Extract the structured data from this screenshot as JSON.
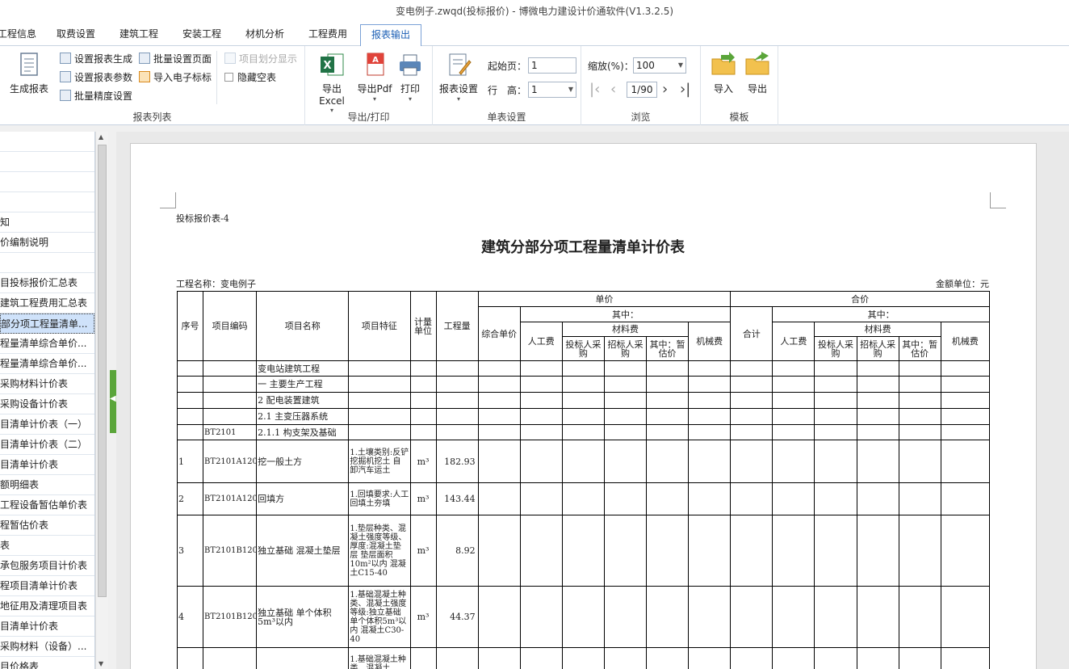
{
  "window": {
    "title": "变电例子.zwqd(投标报价) - 博微电力建设计价通软件(V1.3.2.5)"
  },
  "tabs": [
    "工程信息",
    "取费设置",
    "建筑工程",
    "安装工程",
    "材机分析",
    "工程费用",
    "报表输出"
  ],
  "ribbon": {
    "report_list": {
      "label": "报表列表",
      "generate": "生成报表",
      "set_generate": "设置报表生成",
      "batch_page": "批量设置页面",
      "set_params": "设置报表参数",
      "import_bid": "导入电子标标",
      "batch_precision": "批量精度设置",
      "item_display": "项目划分显示",
      "hide_empty": "隐藏空表"
    },
    "export": {
      "label": "导出/打印",
      "excel": "导出Excel",
      "pdf": "导出Pdf",
      "print": "打印"
    },
    "single": {
      "label": "单表设置",
      "button": "报表设置",
      "start_page_label": "起始页：",
      "start_page": "1",
      "row_height_label": "行　高：",
      "row_height": "1"
    },
    "browse": {
      "label": "浏览",
      "zoom_label": "缩放(%)：",
      "zoom": "100",
      "page": "1/90"
    },
    "template": {
      "label": "模板",
      "import": "导入",
      "export": "导出"
    }
  },
  "left_list": [
    "",
    "",
    "",
    "",
    "知",
    "价编制说明",
    "",
    "目投标报价汇总表",
    "建筑工程费用汇总表",
    "部分项工程量清单...",
    "程量清单综合单价...",
    "程量清单综合单价...",
    "采购材料计价表",
    "采购设备计价表",
    "目清单计价表（一）",
    "目清单计价表（二）",
    "目清单计价表",
    "额明细表",
    "工程设备暂估单价表",
    "程暂估价表",
    "表",
    "承包服务项目计价表",
    "程项目清单计价表",
    "地征用及清理项目表",
    "目清单计价表",
    "采购材料（设备）...",
    "目价格表"
  ],
  "report": {
    "sub": "投标报价表-4",
    "title": "建筑分部分项工程量清单计价表",
    "project": "工程名称：变电例子",
    "unit": "金额单位：元",
    "headers": {
      "seq": "序号",
      "code": "项目编码",
      "name": "项目名称",
      "feature": "项目特征",
      "unit": "计量单位",
      "qty": "工程量",
      "unit_price": "单价",
      "total_price": "合价",
      "combined": "综合单价",
      "total": "合计",
      "among": "其中：",
      "labor": "人工费",
      "material": "材料费",
      "bidder_buy": "投标人采购",
      "tenderer_buy": "招标人采购",
      "provisional": "其中：暂估价",
      "machine": "机械费"
    },
    "rows": [
      {
        "seq": "",
        "code": "",
        "name": "变电站建筑工程",
        "feature": "",
        "unit": "",
        "qty": ""
      },
      {
        "seq": "",
        "code": "",
        "name": "一 主要生产工程",
        "feature": "",
        "unit": "",
        "qty": ""
      },
      {
        "seq": "",
        "code": "",
        "name": "2 配电装置建筑",
        "feature": "",
        "unit": "",
        "qty": ""
      },
      {
        "seq": "",
        "code": "",
        "name": "2.1 主变压器系统",
        "feature": "",
        "unit": "",
        "qty": ""
      },
      {
        "seq": "",
        "code": "BT2101",
        "name": "2.1.1 构支架及基础",
        "feature": "",
        "unit": "",
        "qty": ""
      },
      {
        "seq": "1",
        "code": "BT2101A12003",
        "name": "挖一般土方",
        "feature": "1.土壤类别:反铲挖掘机挖土 自卸汽车运土",
        "unit": "m³",
        "qty": "182.93"
      },
      {
        "seq": "2",
        "code": "BT2101A12004",
        "name": "回填方",
        "feature": "1.回填要求:人工回填土夯填",
        "unit": "m³",
        "qty": "143.44"
      },
      {
        "seq": "3",
        "code": "BT2101B12001",
        "name": "独立基础 混凝土垫层",
        "feature": "1.垫层种类、混凝土强度等级、厚度:混凝土垫层 垫层面积10m²以内 混凝土C15-40",
        "unit": "m³",
        "qty": "8.92"
      },
      {
        "seq": "4",
        "code": "BT2101B12002",
        "name": "独立基础 单个体积5m³以内",
        "feature": "1.基础混凝土种类、混凝土强度等级:独立基础 单个体积5m³以内 混凝土C30-40",
        "unit": "m³",
        "qty": "44.37"
      },
      {
        "seq": "",
        "code": "",
        "name": "",
        "feature": "1.基础混凝土种类、混凝土",
        "unit": "",
        "qty": ""
      }
    ]
  },
  "colors": {
    "accent": "#1c5fb5",
    "selected": "#cfe2fa",
    "splitter": "#5aa53a"
  }
}
